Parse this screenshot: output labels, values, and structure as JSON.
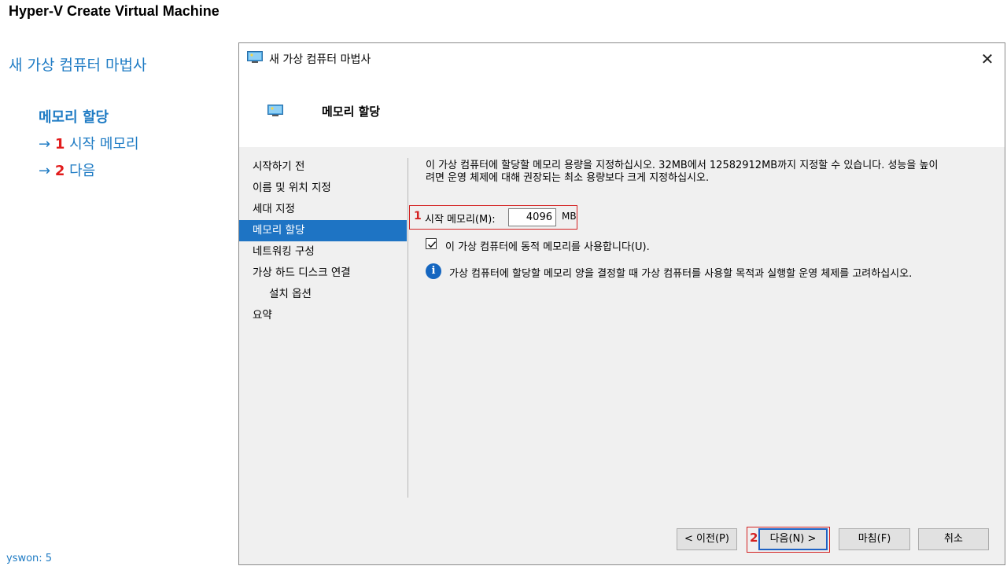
{
  "page": {
    "title": "Hyper-V Create Virtual Machine",
    "left_heading": "새 가상 컴퓨터 마법사",
    "section": "메모리 할당",
    "steps": [
      {
        "arrow": "→",
        "num": "1",
        "label": "시작 메모리"
      },
      {
        "arrow": "→",
        "num": "2",
        "label": "다음"
      }
    ],
    "footer": "yswon:   5"
  },
  "dialog": {
    "title": "새 가상 컴퓨터 마법사",
    "close_glyph": "✕",
    "header_title": "메모리 할당",
    "nav": [
      {
        "label": "시작하기 전"
      },
      {
        "label": "이름 및 위치 지정"
      },
      {
        "label": "세대 지정"
      },
      {
        "label": "메모리 할당"
      },
      {
        "label": "네트워킹 구성"
      },
      {
        "label": "가상 하드 디스크 연결"
      },
      {
        "label": "설치 옵션"
      },
      {
        "label": "요약"
      }
    ],
    "description_line1": "이 가상 컴퓨터에 할당할 메모리 용량을 지정하십시오. 32MB에서 12582912MB까지 지정할 수 있습니다. 성능을 높이",
    "description_line2": "려면 운영 체제에 대해 권장되는 최소 용량보다 크게 지정하십시오.",
    "startup_memory": {
      "marker": "1",
      "label": "시작 메모리(M):",
      "value": "4096",
      "unit": "MB"
    },
    "dynamic_memory": {
      "label": "이 가상 컴퓨터에 동적 메모리를 사용합니다(U).",
      "checked": true
    },
    "info_text": "가상 컴퓨터에 할당할 메모리 양을 결정할 때 가상 컴퓨터를 사용할 목적과 실행할 운영 체제를 고려하십시오.",
    "buttons": {
      "previous": "< 이전(P)",
      "next_marker": "2",
      "next": "다음(N) >",
      "finish": "마침(F)",
      "cancel": "취소"
    }
  },
  "colors": {
    "accent_blue": "#1e7bc4",
    "annotation_red": "#d32121",
    "nav_selected": "#1e74c4",
    "body_gray": "#f0f0f0"
  }
}
